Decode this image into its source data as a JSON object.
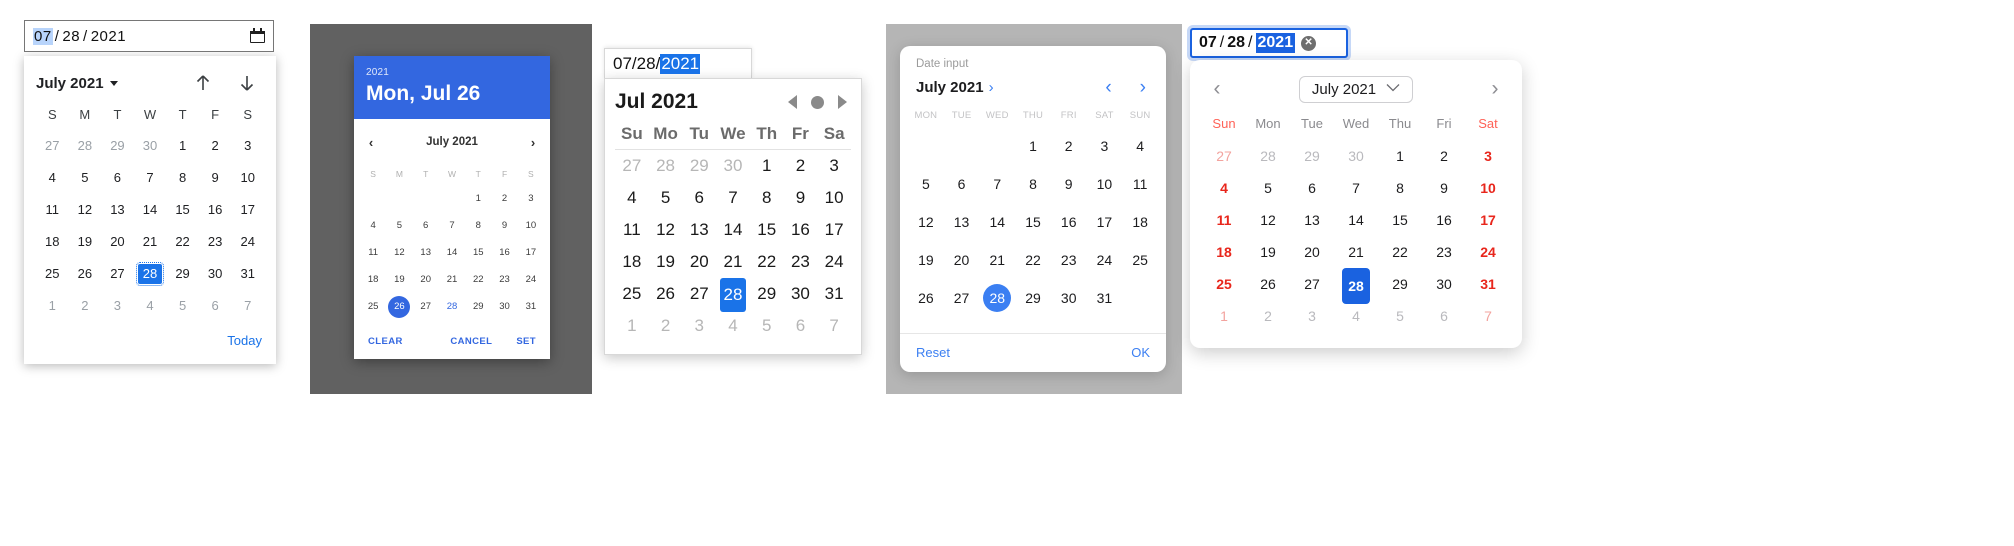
{
  "pickers": {
    "chrome": {
      "input": {
        "month": "07",
        "day": "28",
        "year": "2021",
        "separator": "/",
        "selected_segment": "month"
      },
      "calendar_icon": "calendar-icon",
      "header": {
        "month_label": "July 2021",
        "prev_label": "↑",
        "next_label": "↓"
      },
      "dow": [
        "S",
        "M",
        "T",
        "W",
        "T",
        "F",
        "S"
      ],
      "weeks": [
        [
          "27",
          "28",
          "29",
          "30",
          "1",
          "2",
          "3"
        ],
        [
          "4",
          "5",
          "6",
          "7",
          "8",
          "9",
          "10"
        ],
        [
          "11",
          "12",
          "13",
          "14",
          "15",
          "16",
          "17"
        ],
        [
          "18",
          "19",
          "20",
          "21",
          "22",
          "23",
          "24"
        ],
        [
          "25",
          "26",
          "27",
          "28",
          "29",
          "30",
          "31"
        ],
        [
          "1",
          "2",
          "3",
          "4",
          "5",
          "6",
          "7"
        ]
      ],
      "out_of_month": [
        [
          0,
          0
        ],
        [
          0,
          1
        ],
        [
          0,
          2
        ],
        [
          0,
          3
        ],
        [
          5,
          0
        ],
        [
          5,
          1
        ],
        [
          5,
          2
        ],
        [
          5,
          3
        ],
        [
          5,
          4
        ],
        [
          5,
          5
        ],
        [
          5,
          6
        ]
      ],
      "selected": [
        4,
        3
      ],
      "today_label": "Today",
      "accent": "#1a73e8"
    },
    "material": {
      "header": {
        "year": "2021",
        "date": "Mon, Jul 26"
      },
      "nav": {
        "prev": "‹",
        "next": "›",
        "month_label": "July 2021"
      },
      "dow": [
        "S",
        "M",
        "T",
        "W",
        "T",
        "F",
        "S"
      ],
      "weeks": [
        [
          "",
          "",
          "",
          "",
          "1",
          "2",
          "3"
        ],
        [
          "4",
          "5",
          "6",
          "7",
          "8",
          "9",
          "10"
        ],
        [
          "11",
          "12",
          "13",
          "14",
          "15",
          "16",
          "17"
        ],
        [
          "18",
          "19",
          "20",
          "21",
          "22",
          "23",
          "24"
        ],
        [
          "25",
          "26",
          "27",
          "28",
          "29",
          "30",
          "31"
        ]
      ],
      "selected": [
        4,
        1
      ],
      "today": [
        4,
        3
      ],
      "buttons": {
        "clear": "CLEAR",
        "cancel": "CANCEL",
        "set": "SET"
      },
      "accent": "#3367e0",
      "backdrop": "#616161"
    },
    "firefox": {
      "input": {
        "month": "07",
        "day": "28",
        "year": "2021",
        "separator": "/",
        "selected_segment": "year"
      },
      "header": {
        "month_label": "Jul 2021",
        "prev": "prev-triangle",
        "today_dot": "dot",
        "next": "next-triangle"
      },
      "dow": [
        "Su",
        "Mo",
        "Tu",
        "We",
        "Th",
        "Fr",
        "Sa"
      ],
      "weeks": [
        [
          "27",
          "28",
          "29",
          "30",
          "1",
          "2",
          "3"
        ],
        [
          "4",
          "5",
          "6",
          "7",
          "8",
          "9",
          "10"
        ],
        [
          "11",
          "12",
          "13",
          "14",
          "15",
          "16",
          "17"
        ],
        [
          "18",
          "19",
          "20",
          "21",
          "22",
          "23",
          "24"
        ],
        [
          "25",
          "26",
          "27",
          "28",
          "29",
          "30",
          "31"
        ],
        [
          "1",
          "2",
          "3",
          "4",
          "5",
          "6",
          "7"
        ]
      ],
      "out_of_month": [
        [
          0,
          0
        ],
        [
          0,
          1
        ],
        [
          0,
          2
        ],
        [
          0,
          3
        ],
        [
          5,
          0
        ],
        [
          5,
          1
        ],
        [
          5,
          2
        ],
        [
          5,
          3
        ],
        [
          5,
          4
        ],
        [
          5,
          5
        ],
        [
          5,
          6
        ]
      ],
      "selected": [
        4,
        3
      ],
      "accent": "#1a73e8"
    },
    "ios": {
      "label": "Date input",
      "header": {
        "month_label": "July 2021",
        "expand": "›",
        "prev": "‹",
        "next": "›"
      },
      "dow": [
        "MON",
        "TUE",
        "WED",
        "THU",
        "FRI",
        "SAT",
        "SUN"
      ],
      "weeks": [
        [
          "",
          "",
          "",
          "1",
          "2",
          "3",
          "4"
        ],
        [
          "5",
          "6",
          "7",
          "8",
          "9",
          "10",
          "11"
        ],
        [
          "12",
          "13",
          "14",
          "15",
          "16",
          "17",
          "18"
        ],
        [
          "19",
          "20",
          "21",
          "22",
          "23",
          "24",
          "25"
        ],
        [
          "26",
          "27",
          "28",
          "29",
          "30",
          "31",
          ""
        ]
      ],
      "selected": [
        4,
        2
      ],
      "buttons": {
        "reset": "Reset",
        "ok": "OK"
      },
      "accent": "#3b7ff2",
      "backdrop": "#b5b5b5"
    },
    "safari": {
      "input": {
        "month": "07",
        "day": "28",
        "year": "2021",
        "separator": "/",
        "selected_segment": "year",
        "clear": "✕"
      },
      "header": {
        "prev": "‹",
        "month_label": "July 2021",
        "dropdown": "⌄",
        "next": "›"
      },
      "dow": [
        "Sun",
        "Mon",
        "Tue",
        "Wed",
        "Thu",
        "Fri",
        "Sat"
      ],
      "weeks": [
        [
          "27",
          "28",
          "29",
          "30",
          "1",
          "2",
          "3"
        ],
        [
          "4",
          "5",
          "6",
          "7",
          "8",
          "9",
          "10"
        ],
        [
          "11",
          "12",
          "13",
          "14",
          "15",
          "16",
          "17"
        ],
        [
          "18",
          "19",
          "20",
          "21",
          "22",
          "23",
          "24"
        ],
        [
          "25",
          "26",
          "27",
          "28",
          "29",
          "30",
          "31"
        ],
        [
          "1",
          "2",
          "3",
          "4",
          "5",
          "6",
          "7"
        ]
      ],
      "out_of_month": [
        [
          0,
          0
        ],
        [
          0,
          1
        ],
        [
          0,
          2
        ],
        [
          0,
          3
        ],
        [
          5,
          0
        ],
        [
          5,
          1
        ],
        [
          5,
          2
        ],
        [
          5,
          3
        ],
        [
          5,
          4
        ],
        [
          5,
          5
        ],
        [
          5,
          6
        ]
      ],
      "weekend_cols": [
        0,
        6
      ],
      "selected": [
        4,
        3
      ],
      "accent": "#1a62e0",
      "weekend_color": "#e8261c"
    }
  }
}
